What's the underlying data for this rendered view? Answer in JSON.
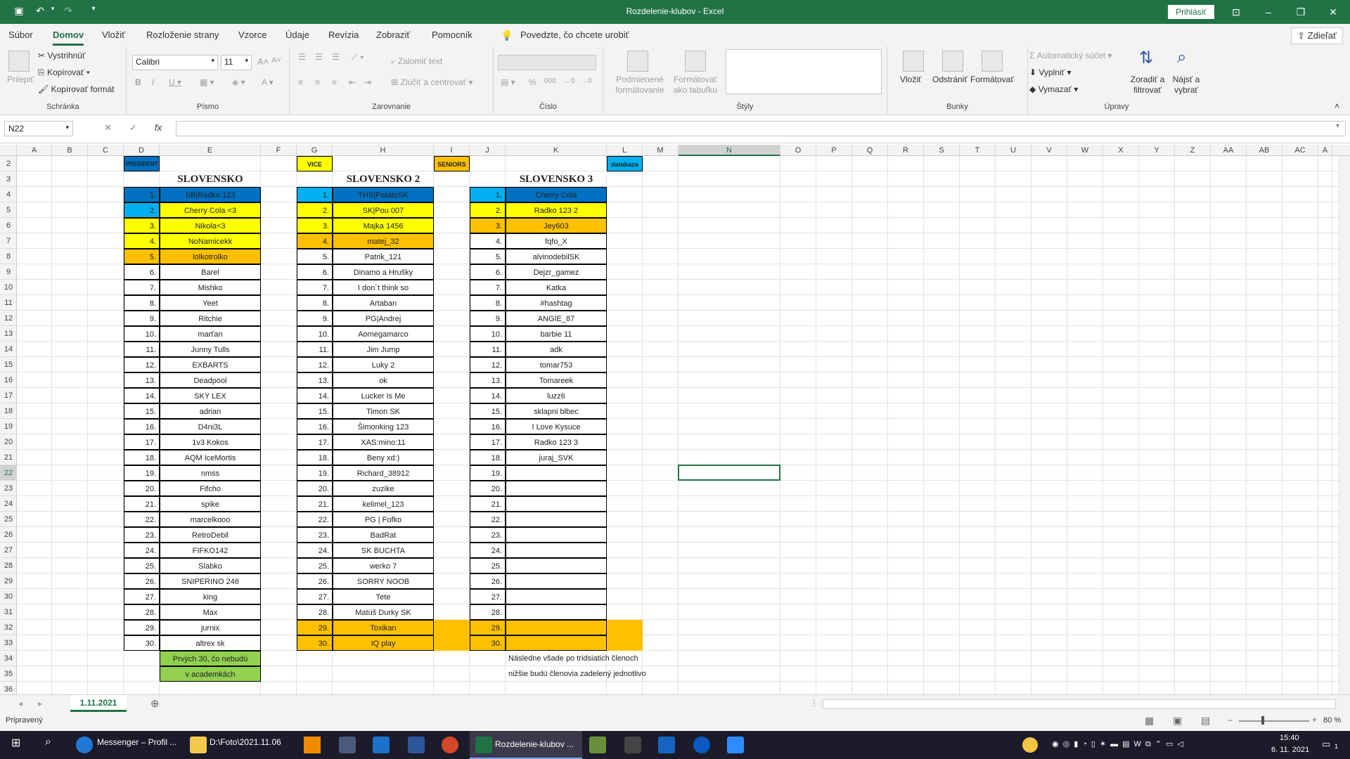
{
  "window": {
    "title": "Rozdelenie-klubov  -  Excel",
    "signin": "Prihlásiť"
  },
  "colors": {
    "excel_green": "#217346",
    "blue": "#0070c0",
    "light_blue": "#00b0f0",
    "yellow": "#ffff00",
    "orange": "#ffc000",
    "green": "#92d050"
  },
  "tabs": [
    "Súbor",
    "Domov",
    "Vložiť",
    "Rozloženie strany",
    "Vzorce",
    "Údaje",
    "Revízia",
    "Zobraziť",
    "Pomocník"
  ],
  "active_tab": "Domov",
  "tell_me": "Povedzte, čo chcete urobiť",
  "share": "Zdieľať",
  "ribbon": {
    "clipboard": {
      "paste": "Prilepiť",
      "cut": "Vystrihnúť",
      "copy": "Kopírovať",
      "format_painter": "Kopírovať formát",
      "label": "Schránka"
    },
    "font": {
      "name": "Calibri",
      "size": "11",
      "label": "Písmo"
    },
    "alignment": {
      "wrap": "Zalomiť text",
      "merge": "Zlúčiť a centrovať",
      "label": "Zarovnanie"
    },
    "number": {
      "label": "Číslo"
    },
    "styles": {
      "conditional": "Podmienené formátovanie",
      "table": "Formátovať ako tabuľku",
      "label": "Štýly"
    },
    "cells": {
      "insert": "Vložiť",
      "delete": "Odstrániť",
      "format": "Formátovať",
      "label": "Bunky"
    },
    "editing": {
      "autosum": "Automatický súčet",
      "fill": "Vyplniť",
      "clear": "Vymazať",
      "sort": "Zoradiť a filtrovať",
      "find": "Nájsť a vybrať",
      "label": "Úpravy"
    }
  },
  "name_box": "N22",
  "columns": [
    "A",
    "B",
    "C",
    "D",
    "E",
    "F",
    "G",
    "H",
    "I",
    "J",
    "K",
    "L",
    "M",
    "N",
    "O",
    "P",
    "Q",
    "R",
    "S",
    "T",
    "U",
    "V",
    "W",
    "X",
    "Y",
    "Z",
    "AA",
    "AB",
    "AC",
    "A"
  ],
  "selected_column": "N",
  "rows": [
    "2",
    "3",
    "4",
    "5",
    "6",
    "7",
    "8",
    "9",
    "10",
    "11",
    "12",
    "13",
    "14",
    "15",
    "16",
    "17",
    "18",
    "19",
    "20",
    "21",
    "22",
    "23",
    "24",
    "25",
    "26",
    "27",
    "28",
    "29",
    "30",
    "31",
    "32",
    "33",
    "34",
    "35",
    "36"
  ],
  "selected_row": "22",
  "labels": {
    "president": "PRESIDENT",
    "vice": "VICE",
    "seniors": "SENIORS",
    "databaza": "databaza"
  },
  "titles": {
    "club1": "SLOVENSKO",
    "club2": "SLOVENSKO 2",
    "club3": "SLOVENSKO 3"
  },
  "numbers": [
    "1.",
    "2.",
    "3.",
    "4.",
    "5.",
    "6.",
    "7.",
    "8.",
    "9.",
    "10.",
    "11.",
    "12.",
    "13.",
    "14.",
    "15.",
    "16.",
    "17.",
    "18.",
    "19.",
    "20.",
    "21.",
    "22.",
    "23.",
    "24.",
    "25.",
    "26.",
    "27.",
    "28.",
    "29.",
    "30."
  ],
  "club1": [
    "SB|Radko 123",
    "Cherry Cola <3",
    "Nikola<3",
    "NoNamicekk",
    "lolkotrolko",
    "Barel",
    "Mishko",
    "Yeet",
    "Ritchie",
    "marťan",
    "Junny Tulls",
    "EXBARTS",
    "Deadpool",
    "SKY LEX",
    "adrian",
    "D4ni3L",
    "1v3 Kokos",
    "AQM IceMortis",
    "nmss",
    "Fifcho",
    "spike",
    "marcelkooo",
    "RetroDebil",
    "FIFKO142",
    "Slabko",
    "SNIPERINO 246",
    "king",
    "Max",
    "jurnix",
    "altrex sk"
  ],
  "club2": [
    "THS|PatatoSK",
    "SK|Pou 007",
    "Majka 1456",
    "matej_32",
    "Patrik_121",
    "Dinamo a Hrušky",
    "I don´t think so",
    "Artaban",
    "PG|Andrej",
    "Aomegamarco",
    "Jim Jump",
    "Luky 2",
    "ok",
    "Lucker Is Me",
    "Timon SK",
    "Šimonking 123",
    "XAS:mino:11",
    "Beny xd:)",
    "Richard_38912",
    "zuzike",
    "kelimel_123",
    "PG | Fofko",
    "BadRat",
    "SK BUCHTA",
    "werko 7",
    "SORRY NOOB",
    "Tete",
    "Matúš Durky SK",
    "Toxikan",
    "IQ play"
  ],
  "club3": [
    "Cherry Cola",
    "Radko 123 2",
    "Jey603",
    "fqfo_X",
    "alvinodebilSK",
    "Dejzr_gamez",
    "Katka",
    "#hashtag",
    "ANGIE_87",
    "barbie 11",
    "adk",
    "tomar753",
    "Tomareek",
    "luzz6",
    "sklapni blbec",
    "I Love Kysuce",
    "Radko 123 3",
    "juraj_SVK",
    "",
    "",
    "",
    "",
    "",
    "",
    "",
    "",
    "",
    "",
    "",
    ""
  ],
  "notes": {
    "green1": "Prvých 30, čo nebudú",
    "green2": "v academkách",
    "line1": "Následne všade po tridsiatich členoch",
    "line2": "nižšie budú členovia zadelený jednotlivo"
  },
  "sheet_tab": "1.11.2021",
  "status": {
    "ready": "Pripravený",
    "zoom": "80 %"
  },
  "taskbar": {
    "messenger": "Messenger – Profil ...",
    "folder": "D:\\Foto\\2021.11.06",
    "excel": "Rozdelenie-klubov ...",
    "time": "15:40",
    "date": "6. 11. 2021",
    "notif": "1"
  }
}
